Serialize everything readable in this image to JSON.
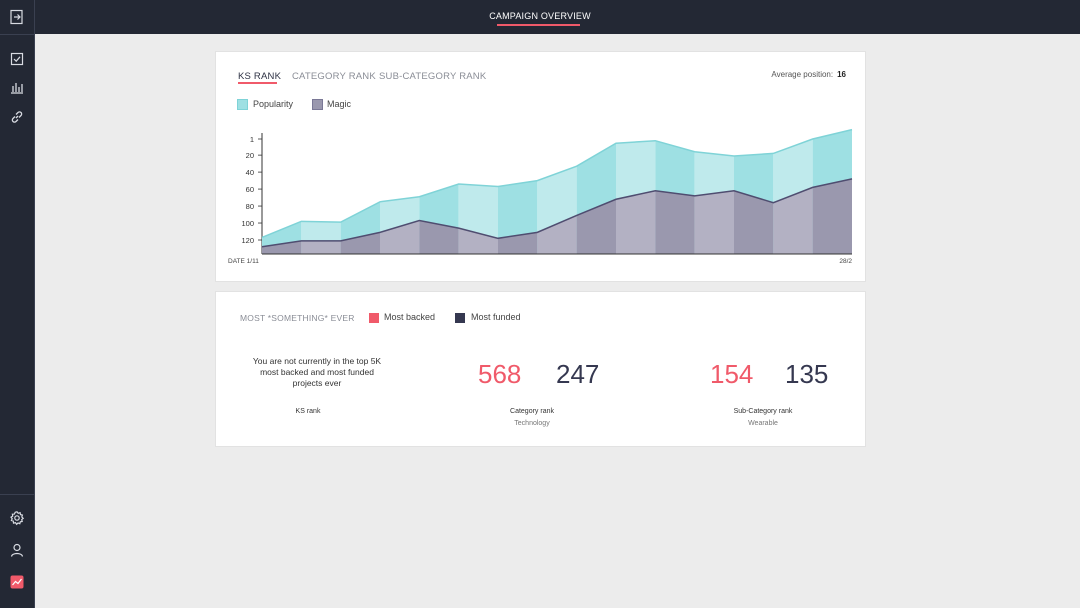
{
  "header": {
    "title": "CAMPAIGN OVERVIEW"
  },
  "sidebar": {
    "top_icons": [
      "exit-icon",
      "checklist-icon",
      "bar-chart-icon",
      "link-icon"
    ],
    "bottom_icons": [
      "settings-icon",
      "user-icon",
      "analytics-icon"
    ]
  },
  "rank_card": {
    "tabs": [
      "KS RANK",
      "CATEGORY RANK",
      "SUB-CATEGORY RANK"
    ],
    "active_tab": "KS RANK",
    "average_label": "Average position:",
    "average_value": "16",
    "legend": [
      {
        "label": "Popularity",
        "color": "#9ee0e3"
      },
      {
        "label": "Magic",
        "color": "#9a98ae"
      }
    ]
  },
  "chart_data": {
    "type": "area",
    "y_ticks": [
      "1",
      "20",
      "40",
      "60",
      "80",
      "100",
      "120"
    ],
    "ylim": [
      1,
      135
    ],
    "y_inverted": true,
    "x_start_label": "DATE 1/11",
    "x_end_label": "28/2",
    "series": [
      {
        "name": "Popularity",
        "color": "#7fd3d7",
        "values": [
          117,
          98,
          99,
          75,
          69,
          54,
          57,
          50,
          33,
          6,
          3,
          16,
          21,
          18,
          1,
          -10
        ]
      },
      {
        "name": "Magic",
        "color": "#7a7896",
        "values": [
          128,
          121,
          121,
          111,
          97,
          106,
          118,
          111,
          91,
          72,
          62,
          68,
          62,
          76,
          58,
          48
        ]
      }
    ]
  },
  "stats_card": {
    "title": "MOST *SOMETHING* EVER",
    "legend": [
      {
        "label": "Most backed",
        "color": "#f05a6a"
      },
      {
        "label": "Most funded",
        "color": "#353850"
      }
    ],
    "ks_message": "You are not currently in the top 5K most backed and most funded projects ever",
    "ks_label": "KS rank",
    "category": {
      "backed": "568",
      "funded": "247",
      "label": "Category rank",
      "sub": "Technology"
    },
    "subcategory": {
      "backed": "154",
      "funded": "135",
      "label": "Sub-Category rank",
      "sub": "Wearable"
    }
  }
}
